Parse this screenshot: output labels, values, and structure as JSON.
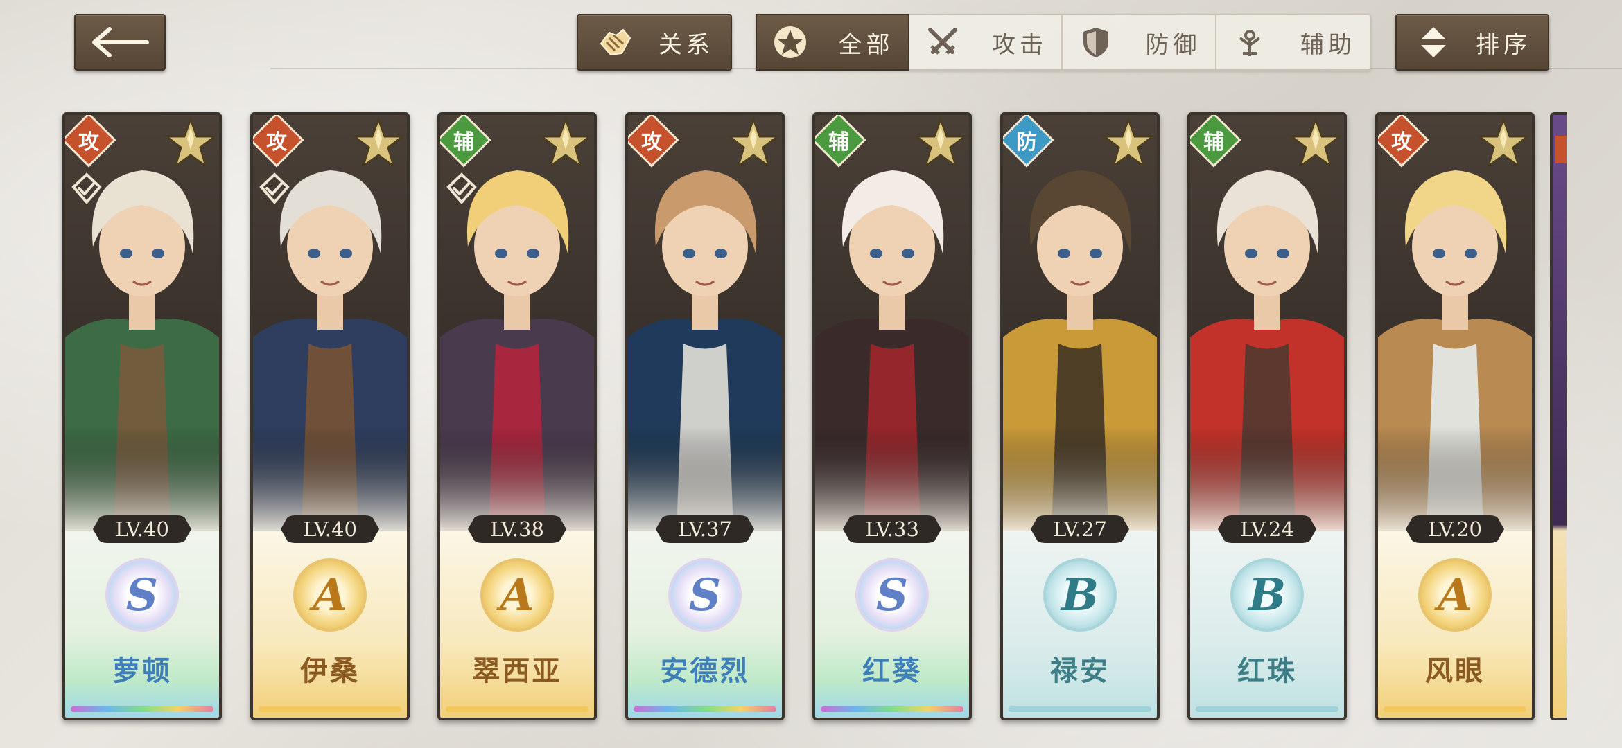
{
  "header": {
    "back_icon": "arrow-left-icon",
    "relations": {
      "label": "关系",
      "icon": "handshake-icon"
    },
    "filters": [
      {
        "label": "全部",
        "icon": "star-emblem-icon",
        "active": true
      },
      {
        "label": "攻击",
        "icon": "crossed-swords-icon",
        "active": false
      },
      {
        "label": "防御",
        "icon": "shield-icon",
        "active": false
      },
      {
        "label": "辅助",
        "icon": "support-staff-icon",
        "active": false
      }
    ],
    "sort": {
      "label": "排序",
      "icon": "sort-arrows-icon"
    }
  },
  "colors": {
    "button_dark": "#5f4f3d",
    "role_attack": "#c6512d",
    "role_support": "#4b9a3f",
    "role_defense": "#3c9ac4"
  },
  "cards": [
    {
      "name": "萝顿",
      "level": "LV.40",
      "rank": "S",
      "role": "攻",
      "role_type": "attack",
      "equipped": true,
      "palette": [
        "#e9e1d2",
        "#3c6b45",
        "#7a5a3c"
      ]
    },
    {
      "name": "伊桑",
      "level": "LV.40",
      "rank": "A",
      "role": "攻",
      "role_type": "attack",
      "equipped": true,
      "palette": [
        "#e4dfd6",
        "#2f3e5e",
        "#7b5432"
      ]
    },
    {
      "name": "翠西亚",
      "level": "LV.38",
      "rank": "A",
      "role": "辅",
      "role_type": "support",
      "equipped": true,
      "palette": [
        "#f0cf78",
        "#4a3a4e",
        "#b8233c"
      ]
    },
    {
      "name": "安德烈",
      "level": "LV.37",
      "rank": "S",
      "role": "攻",
      "role_type": "attack",
      "equipped": false,
      "palette": [
        "#c99a6c",
        "#1f3a5a",
        "#efeae0"
      ]
    },
    {
      "name": "红葵",
      "level": "LV.33",
      "rank": "S",
      "role": "辅",
      "role_type": "support",
      "equipped": false,
      "palette": [
        "#f3ece6",
        "#3a2a2a",
        "#a6262c"
      ]
    },
    {
      "name": "禄安",
      "level": "LV.27",
      "rank": "B",
      "role": "防",
      "role_type": "defense",
      "equipped": false,
      "palette": [
        "#5a4733",
        "#c99a38",
        "#3a2f24"
      ]
    },
    {
      "name": "红珠",
      "level": "LV.24",
      "rank": "B",
      "role": "辅",
      "role_type": "support",
      "equipped": false,
      "palette": [
        "#eae2d6",
        "#c2322a",
        "#4a3a30"
      ]
    },
    {
      "name": "风眼",
      "level": "LV.20",
      "rank": "A",
      "role": "攻",
      "role_type": "attack",
      "equipped": false,
      "palette": [
        "#f1d68a",
        "#b98a52",
        "#e9f1f4"
      ]
    }
  ]
}
